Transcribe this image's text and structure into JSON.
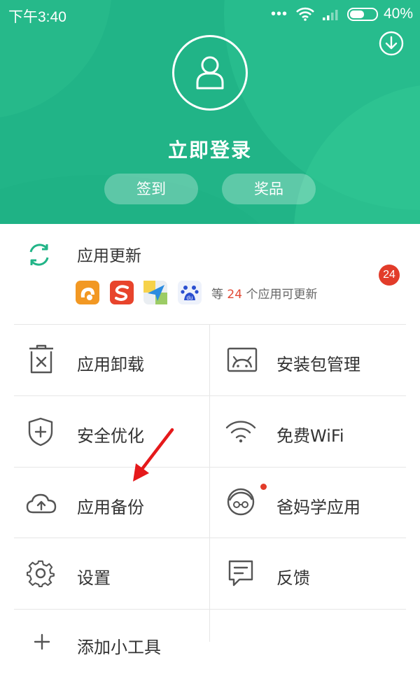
{
  "status_bar": {
    "time": "下午3:40",
    "dots": "•••",
    "battery": "40%"
  },
  "header": {
    "login_label": "立即登录",
    "checkin_label": "签到",
    "prize_label": "奖品"
  },
  "updates": {
    "title": "应用更新",
    "note_prefix": "等 ",
    "count": "24",
    "note_suffix": " 个应用可更新",
    "badge": "24",
    "apps": [
      "uc-browser-icon",
      "sogou-icon",
      "maps-icon",
      "baidu-icon"
    ]
  },
  "menu": {
    "uninstall": "应用卸载",
    "package_manager": "安装包管理",
    "security": "安全优化",
    "free_wifi": "免费WiFi",
    "backup": "应用备份",
    "parents_apps": "爸妈学应用",
    "settings": "设置",
    "feedback": "反馈",
    "add_widget": "添加小工具"
  },
  "colors": {
    "accent": "#21b487",
    "badge": "#e23c2a"
  }
}
